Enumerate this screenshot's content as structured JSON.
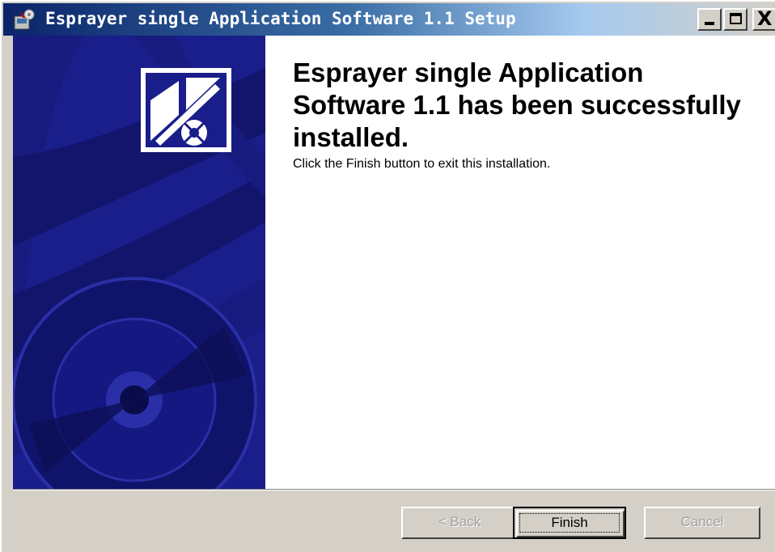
{
  "window": {
    "title": "Esprayer single Application Software 1.1 Setup",
    "title_icon": "installer-icon",
    "controls": [
      "minimize-icon",
      "maximize-icon",
      "close-icon"
    ],
    "close_glyph": "X"
  },
  "content": {
    "heading": "Esprayer single Application Software 1.1 has been successfully installed.",
    "description": "Click the Finish button to exit this installation."
  },
  "buttons": {
    "back_label": "< Back",
    "finish_label": "Finish",
    "cancel_label": "Cancel",
    "back_enabled": false,
    "cancel_enabled": false
  },
  "colors": {
    "title_active": "#0a246a",
    "banner": "#1a1e8a",
    "dialog_face": "#d4d0c8"
  }
}
